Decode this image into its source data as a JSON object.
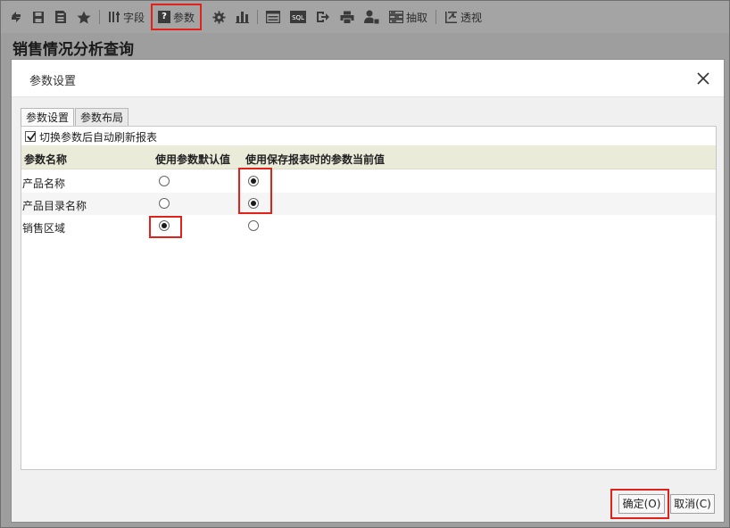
{
  "toolbar": {
    "refresh_icon": "refresh-icon",
    "save_icon": "save-icon",
    "save_as_icon": "save-as-icon",
    "favorite_icon": "star-icon",
    "fields_label": "字段",
    "params_label": "参数",
    "settings_icon": "gear-icon",
    "chart_icon": "bar-chart-icon",
    "table_icon": "table-icon",
    "sql_label": "SQL",
    "export_icon": "export-icon",
    "print_icon": "printer-icon",
    "user_icon": "user-icon",
    "extract_label": "抽取",
    "pivot_label": "透视",
    "highlight_color": "#e0221a"
  },
  "page": {
    "title": "销售情况分析查询"
  },
  "dialog": {
    "title": "参数设置",
    "tabs": [
      "参数设置",
      "参数布局"
    ],
    "active_tab": 0,
    "auto_refresh_label": "切换参数后自动刷新报表",
    "auto_refresh_checked": true,
    "columns": [
      "参数名称",
      "使用参数默认值",
      "使用保存报表时的参数当前值"
    ],
    "rows": [
      {
        "name": "产品名称",
        "selection": "saved"
      },
      {
        "name": "产品目录名称",
        "selection": "saved"
      },
      {
        "name": "销售区域",
        "selection": "default"
      }
    ],
    "ok_label": "确定(O)",
    "cancel_label": "取消(C)"
  }
}
